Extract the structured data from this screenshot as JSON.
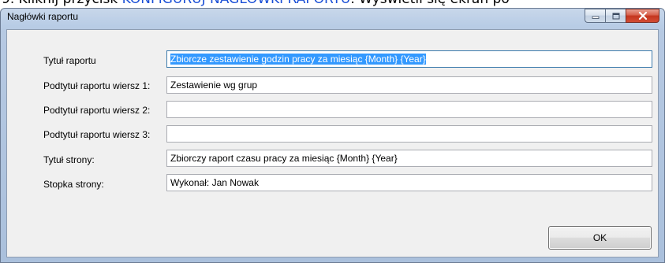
{
  "top_strip": {
    "lead": "9.  Kliknij przycisk ",
    "link": "KONFIGURUJ NAGŁÓWKI RAPORTU",
    "tail": ". Wyświetli się ekran po"
  },
  "window": {
    "title": "Nagłówki raportu",
    "buttons": {
      "minimize_icon": "minimize-icon",
      "maximize_icon": "maximize-icon",
      "close_icon": "close-icon"
    }
  },
  "form": {
    "fields": [
      {
        "label": "Tytuł raportu",
        "value": "Zbiorcze zestawienie godzin pracy za miesiąc {Month} {Year}"
      },
      {
        "label": "Podtytuł raportu wiersz 1:",
        "value": "Zestawienie wg grup"
      },
      {
        "label": "Podtytuł raportu wiersz 2:",
        "value": ""
      },
      {
        "label": "Podtytuł raportu wiersz 3:",
        "value": ""
      },
      {
        "label": "Tytuł strony:",
        "value": "Zbiorczy raport czasu pracy za miesiąc {Month} {Year}"
      },
      {
        "label": "Stopka strony:",
        "value": "Wykonał: Jan Nowak"
      }
    ]
  },
  "ok_label": "OK",
  "colors": {
    "selection": "#3399ff",
    "close_button": "#c4361f",
    "link": "#1a4fd6"
  }
}
